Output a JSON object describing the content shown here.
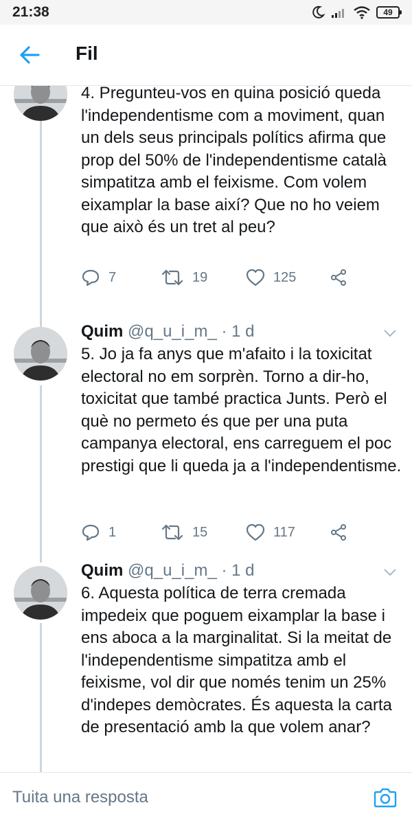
{
  "status_bar": {
    "time": "21:38",
    "battery": "49",
    "icons": [
      "moon-icon",
      "signal-icon",
      "wifi-icon",
      "battery-icon"
    ]
  },
  "header": {
    "back_icon": "arrow-left-icon",
    "title": "Fil"
  },
  "colors": {
    "accent": "#1da1f2",
    "secondary_text": "#657786",
    "thread_line": "#ccd6dd"
  },
  "tweets": [
    {
      "text": "4. Pregunteu-vos en quina posició queda l'independentisme com a moviment, quan un dels seus principals polítics afirma que prop del 50% de l'independentisme català simpatitza amb el feixisme. Com volem eixamplar la base així? Que no ho veiem que això és un tret al peu?",
      "replies": "7",
      "retweets": "19",
      "likes": "125"
    },
    {
      "name": "Quim",
      "handle": "@q_u_i_m_",
      "separator": "·",
      "time": "1 d",
      "text": "5. Jo ja fa anys que m'afaito i la toxicitat electoral no em sorprèn. Torno a dir-ho, toxicitat que també practica Junts. Però el què no permeto és que per una puta campanya electoral, ens carreguem el poc prestigi que li queda ja a l'independentisme.",
      "replies": "1",
      "retweets": "15",
      "likes": "117"
    },
    {
      "name": "Quim",
      "handle": "@q_u_i_m_",
      "separator": "·",
      "time": "1 d",
      "text": "6. Aquesta política de terra cremada impedeix que poguem eixamplar la base i ens aboca a la marginalitat. Si la meitat de l'independentisme simpatitza amb el feixisme, vol dir que només tenim un 25% d'indepes demòcrates. És aquesta la carta de presentació amb la que volem anar?"
    }
  ],
  "reply_bar": {
    "placeholder": "Tuita una resposta",
    "camera_icon": "camera-icon"
  }
}
